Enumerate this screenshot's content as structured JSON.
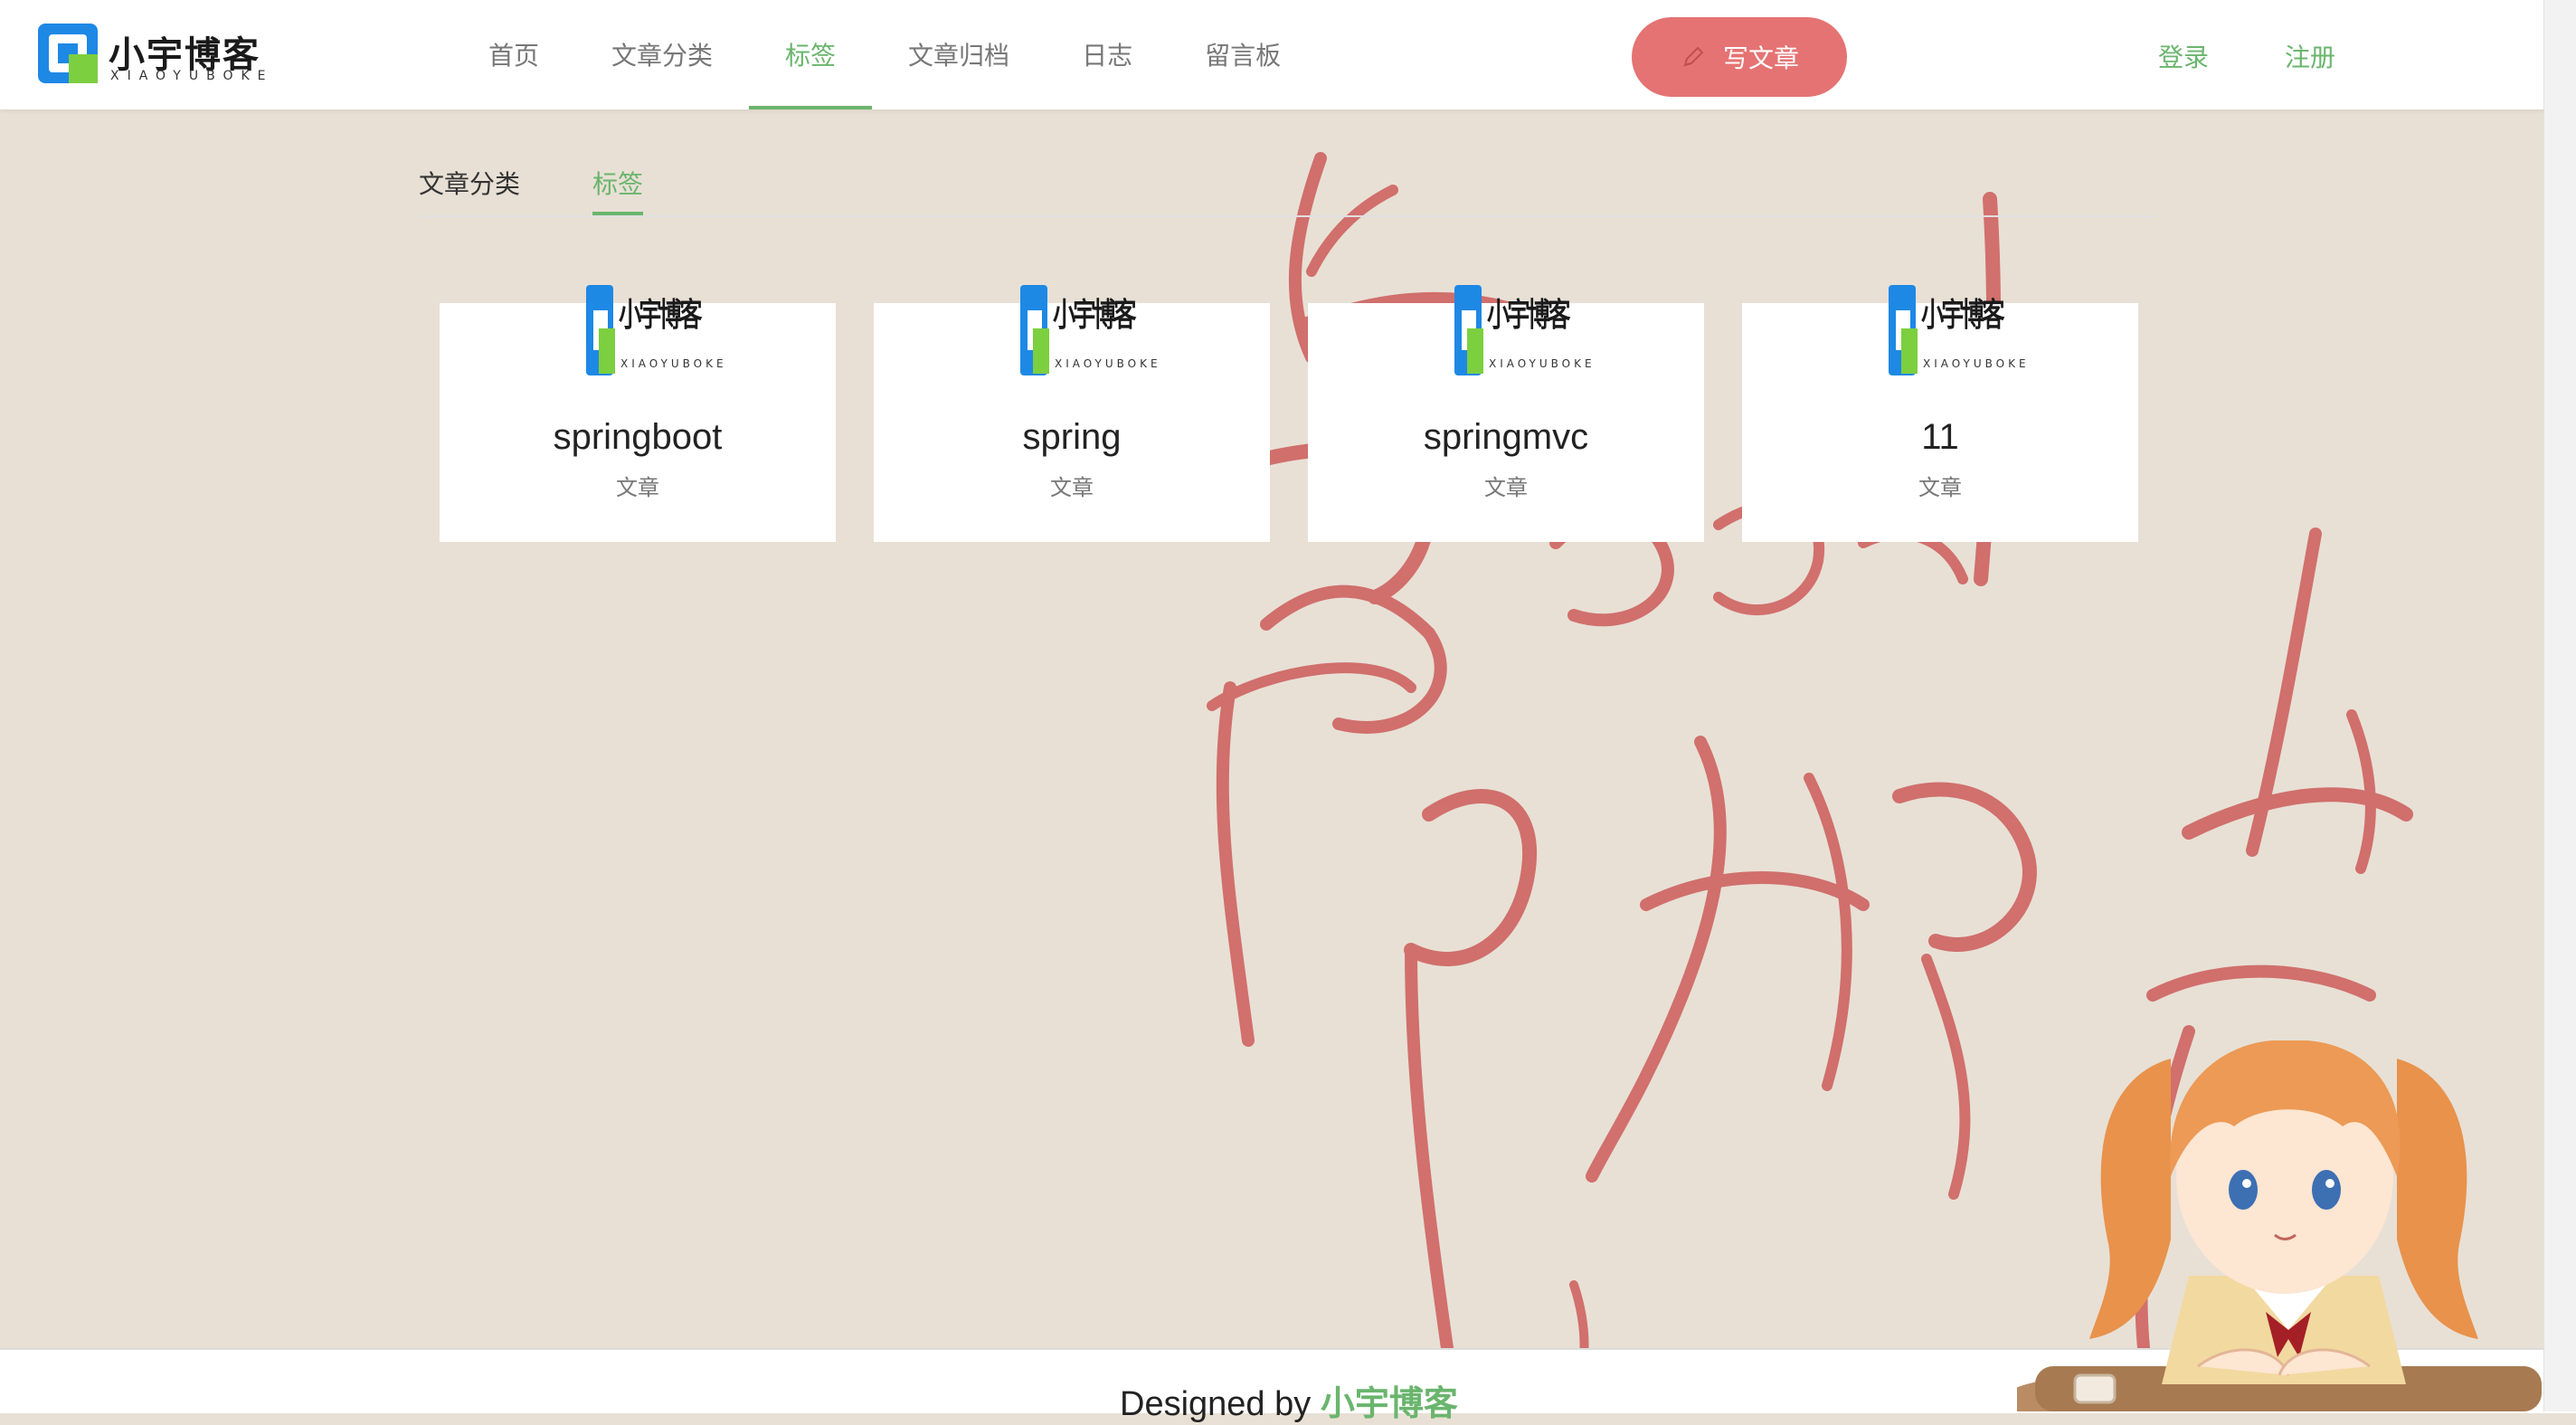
{
  "brand": {
    "name_cn": "小宇博客",
    "name_en": "XIAOYUBOKE"
  },
  "nav": {
    "items": [
      {
        "label": "首页"
      },
      {
        "label": "文章分类"
      },
      {
        "label": "标签"
      },
      {
        "label": "文章归档"
      },
      {
        "label": "日志"
      },
      {
        "label": "留言板"
      }
    ],
    "active": "标签"
  },
  "header": {
    "write_label": "写文章",
    "login_label": "登录",
    "register_label": "注册"
  },
  "subtabs": {
    "items": [
      {
        "label": "文章分类"
      },
      {
        "label": "标签"
      }
    ],
    "active": "标签"
  },
  "tags": [
    {
      "name": "springboot",
      "sub": "文章"
    },
    {
      "name": "spring",
      "sub": "文章"
    },
    {
      "name": "springmvc",
      "sub": "文章"
    },
    {
      "name": "11",
      "sub": "文章"
    }
  ],
  "footer": {
    "prefix": "Designed by ",
    "brand": "小宇博客"
  },
  "colors": {
    "accent": "#6ab56d",
    "write_button": "#e57373",
    "background": "#e8e0d5",
    "calligraphy": "#c95a58"
  },
  "icons": [
    "pen-icon"
  ]
}
